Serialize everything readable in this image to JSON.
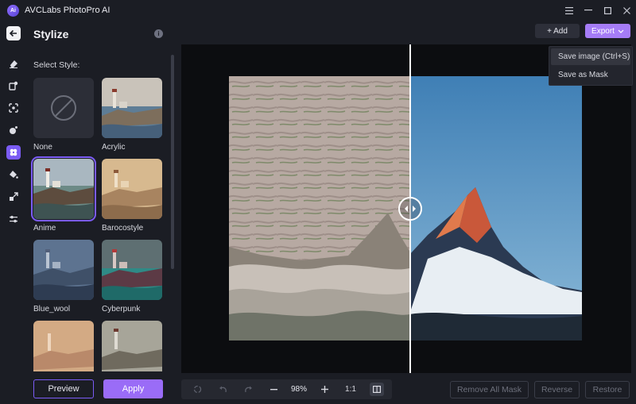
{
  "app": {
    "title": "AVCLabs PhotoPro AI",
    "logo_text": "Ai"
  },
  "window_controls": [
    "menu-icon",
    "minimize-icon",
    "maximize-icon",
    "close-icon"
  ],
  "panel": {
    "title": "Stylize",
    "select_label": "Select Style:",
    "styles": [
      {
        "name": "None"
      },
      {
        "name": "Acrylic"
      },
      {
        "name": "Anime",
        "selected": true
      },
      {
        "name": "Barocostyle"
      },
      {
        "name": "Blue_wool"
      },
      {
        "name": "Cyberpunk"
      },
      {
        "name": ""
      },
      {
        "name": ""
      }
    ],
    "preview_label": "Preview",
    "apply_label": "Apply"
  },
  "rail_icons": [
    "eraser-icon",
    "retouch-icon",
    "enhance-icon",
    "colorize-icon",
    "stylize-icon",
    "fill-icon",
    "resize-icon",
    "adjust-icon"
  ],
  "toolbar": {
    "add_label": "+ Add",
    "export_label": "Export",
    "export_menu": [
      "Save image (Ctrl+S)",
      "Save as Mask"
    ]
  },
  "bottom": {
    "zoom": "98%",
    "fit_label": "1:1",
    "remove_all_mask": "Remove All Mask",
    "reverse": "Reverse",
    "restore": "Restore"
  },
  "colors": {
    "accent": "#7b5cf5",
    "export": "#a57cf7",
    "bg": "#1b1d24",
    "canvas": "#0c0d10"
  }
}
